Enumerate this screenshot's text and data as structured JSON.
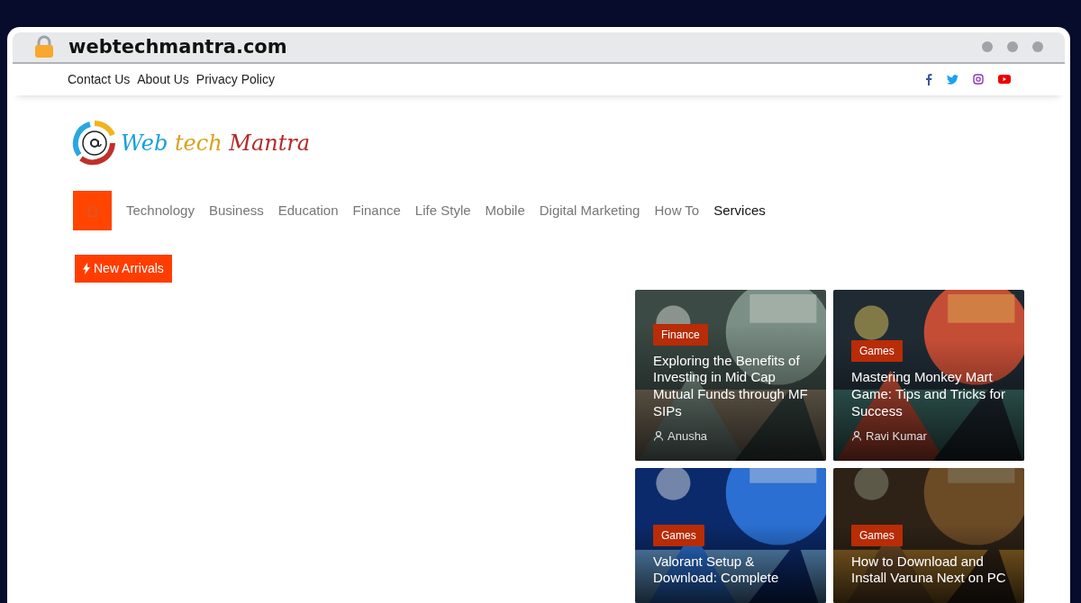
{
  "browser": {
    "address": "webtechmantra.com"
  },
  "top_links": [
    "Contact Us",
    "About Us",
    "Privacy Policy"
  ],
  "logo": {
    "parts": [
      {
        "text": "Web",
        "color": "#1a9fd8"
      },
      {
        "text": "tech",
        "color": "#d9a21b"
      },
      {
        "text": "Mantra",
        "color": "#b52a2a"
      }
    ]
  },
  "nav": [
    {
      "label": "Technology",
      "selected": false
    },
    {
      "label": "Business",
      "selected": false
    },
    {
      "label": "Education",
      "selected": false
    },
    {
      "label": "Finance",
      "selected": false
    },
    {
      "label": "Life Style",
      "selected": false
    },
    {
      "label": "Mobile",
      "selected": false
    },
    {
      "label": "Digital Marketing",
      "selected": false
    },
    {
      "label": "How To",
      "selected": false
    },
    {
      "label": "Services",
      "selected": true
    }
  ],
  "new_arrivals": "New Arrivals",
  "posts": [
    {
      "category": "Finance",
      "title": "Exploring the Benefits of Investing in Mid Cap Mutual Funds through MF SIPs",
      "author": "Anusha",
      "kind": "picture"
    },
    {
      "category": "Games",
      "title": "Mastering Monkey Mart Game: Tips and Tricks for Success",
      "author": "Ravi Kumar",
      "kind": "picture"
    },
    {
      "category": "Games",
      "title": "Valorant Setup & Download: Complete",
      "kind": "picture"
    },
    {
      "category": "Games",
      "title": "How to Download and Install Varuna Next on PC",
      "kind": "picture"
    }
  ]
}
